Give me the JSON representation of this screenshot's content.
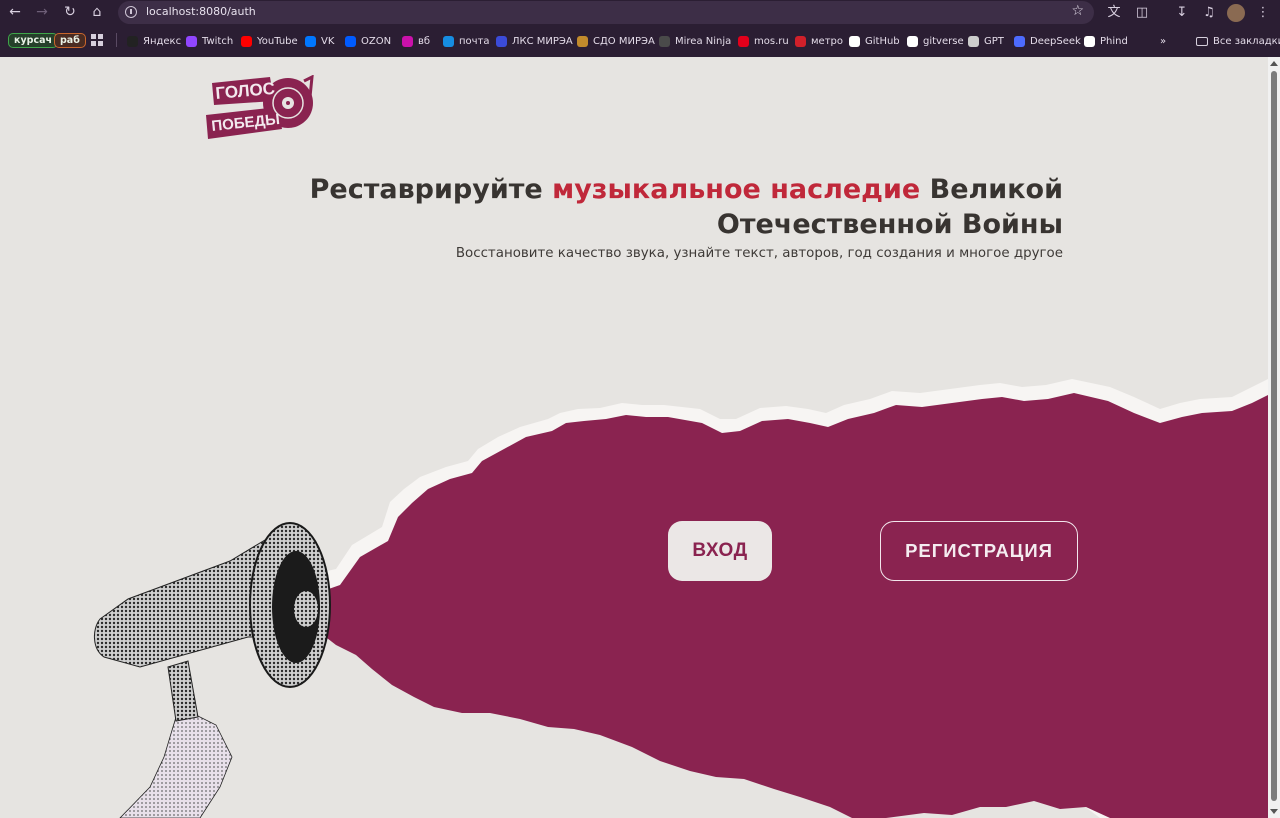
{
  "browser": {
    "url": "localhost:8080/auth",
    "bookmarks": [
      {
        "label": "Яндекс",
        "color": "#222222"
      },
      {
        "label": "Twitch",
        "color": "#9146ff"
      },
      {
        "label": "YouTube",
        "color": "#ff0000"
      },
      {
        "label": "VK",
        "color": "#0077ff"
      },
      {
        "label": "OZON",
        "color": "#005bff"
      },
      {
        "label": "вб",
        "color": "#cb11ab"
      },
      {
        "label": "почта",
        "color": "#168de2"
      },
      {
        "label": "ЛКС МИРЭА",
        "color": "#3b4bd8"
      },
      {
        "label": "СДО МИРЭА",
        "color": "#c28b2c"
      },
      {
        "label": "Mirea Ninja",
        "color": "#4a4a4a"
      },
      {
        "label": "mos.ru",
        "color": "#e3001b"
      },
      {
        "label": "метро",
        "color": "#d1202a"
      },
      {
        "label": "GitHub",
        "color": "#ffffff"
      },
      {
        "label": "gitverse",
        "color": "#ffffff"
      },
      {
        "label": "GPT",
        "color": "#cccccc"
      },
      {
        "label": "DeepSeek",
        "color": "#4d6bfe"
      },
      {
        "label": "Phind",
        "color": "#ffffff"
      }
    ],
    "chips": [
      {
        "label": "курсач",
        "color": "#3fa64a"
      },
      {
        "label": "раб",
        "color": "#c8662c"
      }
    ],
    "all_bookmarks": "Все закладки"
  },
  "logo": {
    "line1": "ГОЛОС",
    "line2": "ПОБЕДЫ"
  },
  "hero": {
    "title_before": "Реставрируйте ",
    "title_accent": "музыкальное наследие",
    "title_after": " Великой Отечественной Войны",
    "subtitle": "Восстановите качество звука, узнайте текст, авторов, год создания и многое другое"
  },
  "actions": {
    "login": "ВХОД",
    "register": "РЕГИСТРАЦИЯ"
  },
  "colors": {
    "brand": "#8a2350",
    "accent": "#c0283a",
    "background": "#e6e4e1"
  }
}
